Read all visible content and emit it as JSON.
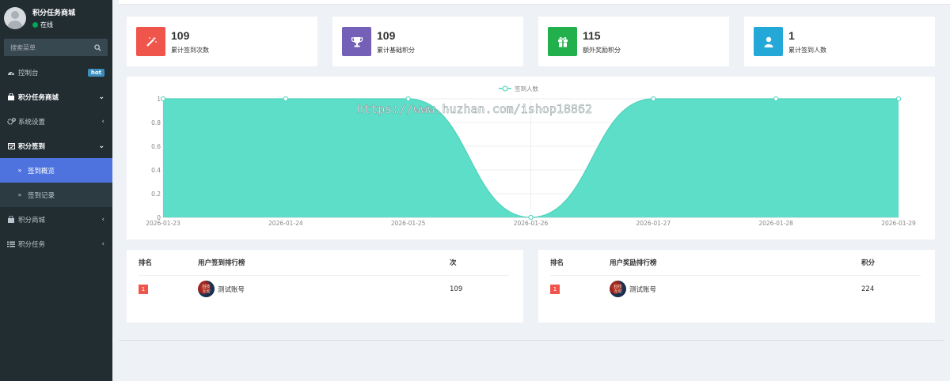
{
  "app": {
    "title": "积分任务商城",
    "status": "在线"
  },
  "search": {
    "placeholder": "搜索菜单"
  },
  "sidebar": {
    "items": [
      {
        "label": "控制台",
        "icon": "dashboard-icon",
        "badge": "hot"
      },
      {
        "label": "积分任务商城",
        "icon": "shop-icon",
        "caret": "chevron-down"
      },
      {
        "label": "系统设置",
        "icon": "gears-icon",
        "caret": "chevron-left"
      },
      {
        "label": "积分签到",
        "icon": "calendar-check-icon",
        "caret": "chevron-down"
      },
      {
        "label": "签到概览",
        "icon": "double-angle-right-icon",
        "active": true
      },
      {
        "label": "签到记录",
        "icon": "double-angle-right-icon"
      },
      {
        "label": "积分商城",
        "icon": "shop-icon",
        "caret": "chevron-left"
      },
      {
        "label": "积分任务",
        "icon": "list-icon",
        "caret": "chevron-left"
      }
    ]
  },
  "stats": [
    {
      "value": "109",
      "label": "累计签到次数",
      "color": "#f0554c",
      "icon": "magic-wand-icon"
    },
    {
      "value": "109",
      "label": "累计基础积分",
      "color": "#7560b8",
      "icon": "trophy-icon"
    },
    {
      "value": "115",
      "label": "额外奖励积分",
      "color": "#21b04b",
      "icon": "gift-icon"
    },
    {
      "value": "1",
      "label": "累计签到人数",
      "color": "#23a8d8",
      "icon": "user-icon"
    }
  ],
  "watermark": "https://www.huzhan.com/ishop18862",
  "chart_data": {
    "type": "area",
    "series": [
      {
        "name": "签到人数",
        "values": [
          1,
          1,
          1,
          0,
          1,
          1,
          1
        ],
        "color": "#5cdec8"
      }
    ],
    "categories": [
      "2026-01-23",
      "2026-01-24",
      "2026-01-25",
      "2026-01-26",
      "2026-01-27",
      "2026-01-28",
      "2026-01-29"
    ],
    "y_ticks": [
      "0",
      "0.2",
      "0.4",
      "0.6",
      "0.8",
      "1"
    ],
    "ylim": [
      0,
      1
    ],
    "smooth": true,
    "legend": "top-center",
    "grid": true
  },
  "rank_sign": {
    "headers": [
      "排名",
      "用户签到排行榜",
      "次"
    ],
    "rows": [
      {
        "rank": "1",
        "user": "测试账号",
        "score": "109"
      }
    ]
  },
  "rank_reward": {
    "headers": [
      "排名",
      "用户奖励排行榜",
      "积分"
    ],
    "rows": [
      {
        "rank": "1",
        "user": "测试账号",
        "score": "224"
      }
    ]
  }
}
